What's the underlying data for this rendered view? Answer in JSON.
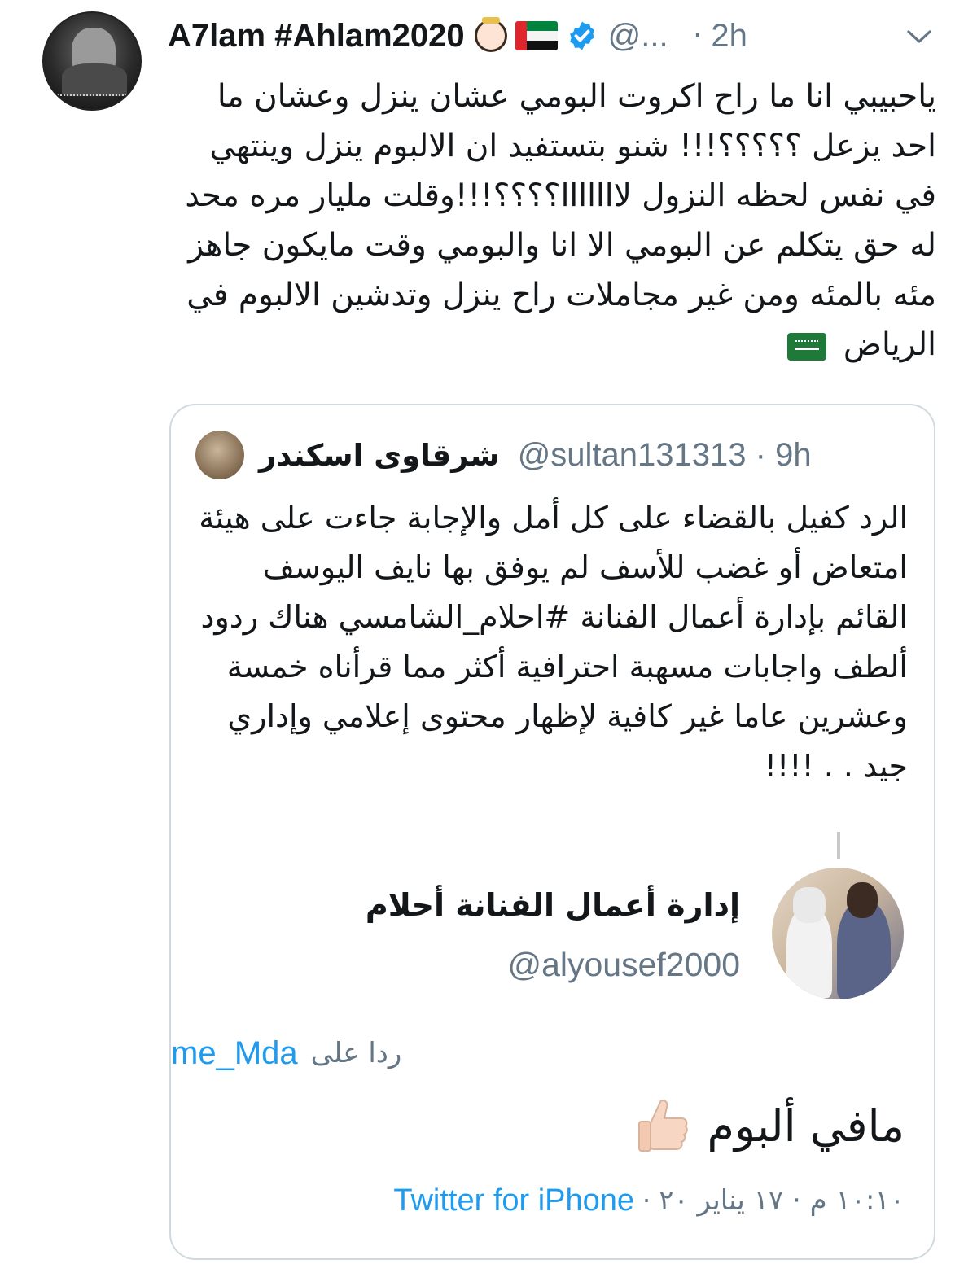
{
  "author": {
    "name": "A7lam #Ahlam2020",
    "handle": "@...",
    "separator": "·",
    "time": "2h"
  },
  "tweet_text": "ياحبيبي انا ما راح اكروت البومي عشان ينزل وعشان ما احد يزعل ؟؟؟؟؟!!! شنو بتستفيد ان الالبوم ينزل وينتهي في نفس لحظه النزول لااااااا؟؟؟؟!!!وقلت مليار مره محد له حق يتكلم عن البومي الا انا والبومي وقت مايكون جاهز مئه بالمئه ومن غير مجاملات راح ينزل وتدشين الالبوم في الرياض",
  "quoted": {
    "name": "شرقاوى اسكندر",
    "handle": "@sultan131313",
    "separator": "·",
    "time": "9h",
    "text": "الرد كفيل بالقضاء على كل أمل والإجابة جاءت على هيئة امتعاض أو غضب للأسف لم يوفق بها نايف اليوسف القائم بإدارة أعمال الفنانة  #احلام_الشامسي هناك ردود ألطف واجابات مسهبة احترافية أكثر مما قرأناه خمسة وعشرين عاما غير كافية لإظهار محتوى إعلامي وإداري جيد . . !!!!",
    "inner": {
      "name": "إدارة أعمال الفنانة أحلام",
      "handle": "@alyousef2000",
      "reply_label": "ردا على",
      "reply_handle": "me_Mda",
      "text": "مافي ألبوم",
      "source": "Twitter for iPhone",
      "meta_sep": "·",
      "date": "١٠:١٠ م · ١٧ يناير ٢٠"
    }
  },
  "colors": {
    "link_blue": "#1d9bf0",
    "secondary_gray": "#657786",
    "text": "#14171a",
    "border": "#cfd9de"
  },
  "icons": [
    "girl-emoji-icon",
    "uae-flag-icon",
    "verified-badge-icon",
    "chevron-down-icon",
    "saudi-flag-icon",
    "thumbs-up-icon"
  ]
}
